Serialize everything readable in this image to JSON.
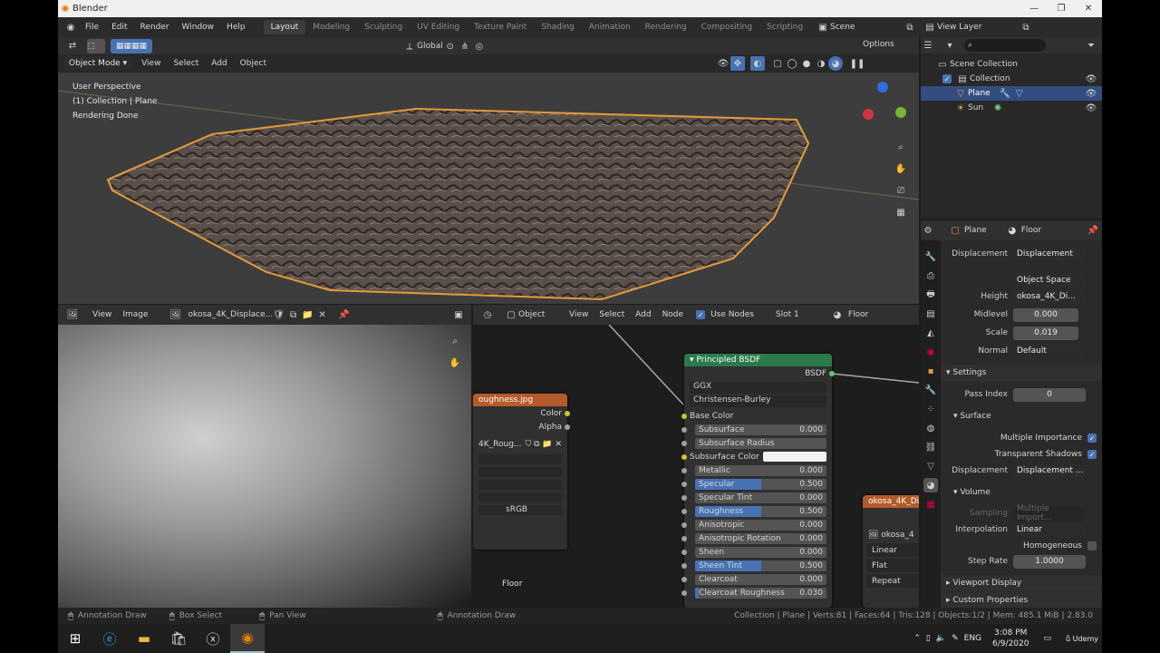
{
  "window": {
    "title": "Blender"
  },
  "menu": [
    "File",
    "Edit",
    "Render",
    "Window",
    "Help"
  ],
  "workspaces": [
    "Layout",
    "Modeling",
    "Sculpting",
    "UV Editing",
    "Texture Paint",
    "Shading",
    "Animation",
    "Rendering",
    "Compositing",
    "Scripting"
  ],
  "scene": "Scene",
  "view_layer": "View Layer",
  "viewport": {
    "mode": "Object Mode",
    "menus": [
      "View",
      "Select",
      "Add",
      "Object"
    ],
    "transform": "Global",
    "options": "Options",
    "overlay": [
      "User Perspective",
      "(1) Collection | Plane",
      "Rendering Done"
    ]
  },
  "outliner": {
    "root": "Scene Collection",
    "items": [
      {
        "label": "Collection"
      },
      {
        "label": "Plane"
      },
      {
        "label": "Sun"
      }
    ]
  },
  "properties": {
    "object": "Plane",
    "material": "Floor",
    "rows": [
      {
        "label": "Displacement",
        "value": "Displacement"
      },
      {
        "label": "",
        "value": "Object Space"
      },
      {
        "label": "Height",
        "value": "okosa_4K_Di..."
      },
      {
        "label": "Midlevel",
        "value": "0.000"
      },
      {
        "label": "Scale",
        "value": "0.019"
      },
      {
        "label": "Normal",
        "value": "Default"
      }
    ],
    "settings": "Settings",
    "pass_index_label": "Pass Index",
    "pass_index": "0",
    "surface": "Surface",
    "multiple_importance": "Multiple Importance",
    "transparent_shadows": "Transparent Shadows",
    "displacement_label": "Displacement",
    "displacement_value": "Displacement ...",
    "volume": "Volume",
    "sampling_label": "Sampling",
    "sampling_value": "Multiple Import...",
    "interpolation_label": "Interpolation",
    "interpolation_value": "Linear",
    "homogeneous": "Homogeneous",
    "step_rate_label": "Step Rate",
    "step_rate": "1.0000",
    "viewport_display": "Viewport Display",
    "custom_properties": "Custom Properties"
  },
  "image_editor": {
    "menus": [
      "View",
      "Image"
    ],
    "image_name": "okosa_4K_Displace..."
  },
  "node_editor": {
    "object": "Object",
    "menus": [
      "View",
      "Select",
      "Add",
      "Node"
    ],
    "use_nodes": "Use Nodes",
    "slot": "Slot 1",
    "material": "Floor",
    "label": "Floor",
    "tex_node": {
      "title": "oughness.jpg",
      "out1": "Color",
      "out2": "Alpha",
      "image": "4K_Roug...",
      "colorspace": "sRGB"
    },
    "bsdf": {
      "title": "Principled BSDF",
      "output": "BSDF",
      "dist": "GGX",
      "sss": "Christensen-Burley",
      "base_color": "Base Color",
      "sss_color": "Subsurface Color",
      "params": [
        {
          "name": "Subsurface",
          "value": "0.000",
          "fill": 0
        },
        {
          "name": "Subsurface Radius",
          "value": "",
          "fill": 0
        },
        {
          "name": "Metallic",
          "value": "0.000",
          "fill": 0
        },
        {
          "name": "Specular",
          "value": "0.500",
          "fill": 0.5
        },
        {
          "name": "Specular Tint",
          "value": "0.000",
          "fill": 0
        },
        {
          "name": "Roughness",
          "value": "0.500",
          "fill": 0.5
        },
        {
          "name": "Anisotropic",
          "value": "0.000",
          "fill": 0
        },
        {
          "name": "Anisotropic Rotation",
          "value": "0.000",
          "fill": 0
        },
        {
          "name": "Sheen",
          "value": "0.000",
          "fill": 0
        },
        {
          "name": "Sheen Tint",
          "value": "0.500",
          "fill": 0.5
        },
        {
          "name": "Clearcoat",
          "value": "0.000",
          "fill": 0
        },
        {
          "name": "Clearcoat Roughness",
          "value": "0.030",
          "fill": 0.03
        }
      ]
    },
    "disp_node": {
      "title": "okosa_4K_Di",
      "image": "okosa_4",
      "options": [
        "Linear",
        "Flat",
        "Repeat"
      ]
    }
  },
  "status": {
    "left": [
      "Annotation Draw",
      "Box Select",
      "Pan View",
      "Annotation Draw"
    ],
    "right": "Collection | Plane | Verts:81 | Faces:64 | Tris:128 | Objects:1/2 | Mem: 485.1 MiB | 2.83.0"
  },
  "taskbar": {
    "lang": "ENG",
    "time": "3:08 PM",
    "date": "6/9/2020",
    "udemy": "Udemy"
  }
}
